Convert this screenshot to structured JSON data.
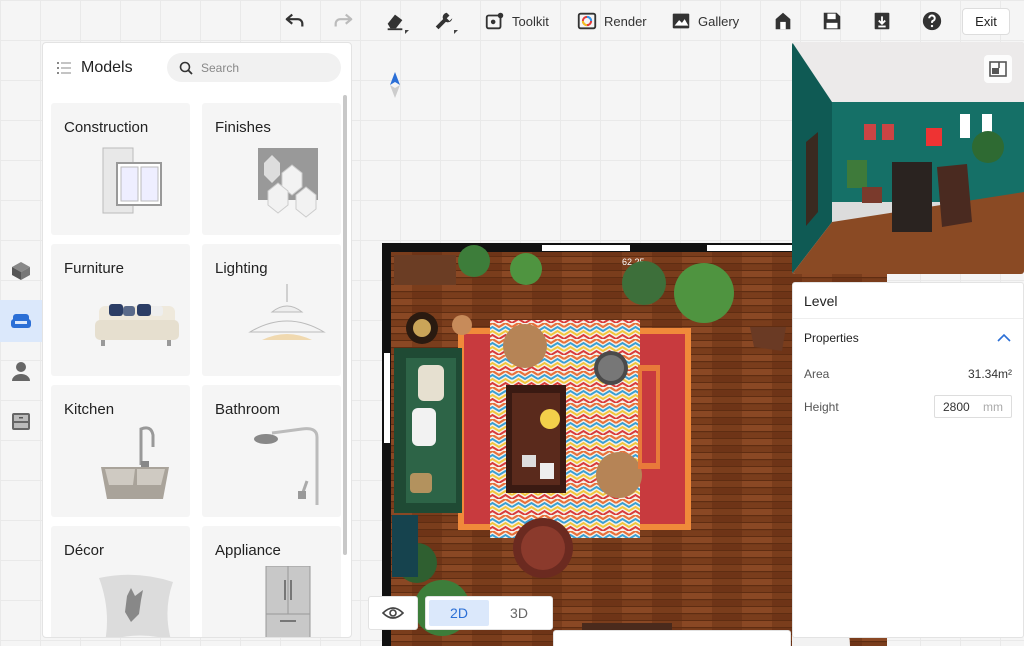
{
  "toolbar": {
    "toolkit_label": "Toolkit",
    "render_label": "Render",
    "gallery_label": "Gallery",
    "exit_label": "Exit"
  },
  "models": {
    "title": "Models",
    "search_placeholder": "Search",
    "categories": [
      {
        "label": "Construction"
      },
      {
        "label": "Finishes"
      },
      {
        "label": "Furniture"
      },
      {
        "label": "Lighting"
      },
      {
        "label": "Kitchen"
      },
      {
        "label": "Bathroom"
      },
      {
        "label": "Décor"
      },
      {
        "label": "Appliance"
      }
    ]
  },
  "plan": {
    "dimension_label": "62.25"
  },
  "properties": {
    "title": "Level",
    "section": "Properties",
    "area_label": "Area",
    "area_value": "31.34m²",
    "height_label": "Height",
    "height_value": "2800",
    "height_unit": "mm"
  },
  "view": {
    "mode_2d": "2D",
    "mode_3d": "3D",
    "active": "2D"
  },
  "colors": {
    "accent": "#2b6fd6",
    "active_bg": "#dbe8fb",
    "floor": "#7a3d1c"
  }
}
